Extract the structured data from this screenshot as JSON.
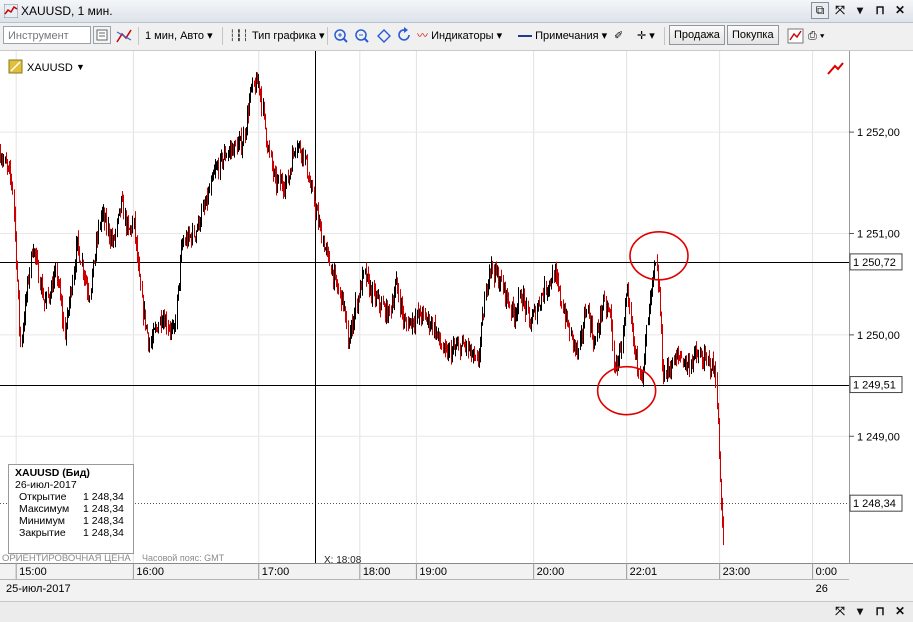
{
  "window": {
    "title": "XAUUSD, 1 мин.",
    "buttons": [
      "restore-icon",
      "close-icon",
      "pin-icon",
      "close-icon"
    ]
  },
  "toolbar": {
    "instrument_placeholder": "Инструмент",
    "timeframe": "1 мин, Авто",
    "chart_type": "Тип графика",
    "indicators": "Индикаторы",
    "notes": "Примечания",
    "sell": "Продажа",
    "buy": "Покупка"
  },
  "symbol_label": "XAUUSD",
  "info_box": {
    "title": "XAUUSD (Бид)",
    "date": "26-июл-2017",
    "rows": [
      {
        "label": "Открытие",
        "value": "1 248,34"
      },
      {
        "label": "Максимум",
        "value": "1 248,34"
      },
      {
        "label": "Минимум",
        "value": "1 248,34"
      },
      {
        "label": "Закрытие",
        "value": "1 248,34"
      }
    ]
  },
  "footer_text": {
    "price_mode": "ОРИЕНТИРОВОЧНАЯ ЦЕНА",
    "timezone": "Часовой пояс: GMT",
    "cursor_x": "X: 18:08"
  },
  "axis": {
    "x_ticks": [
      {
        "label": "15:00",
        "t": 2.0
      },
      {
        "label": "16:00",
        "t": 16.5
      },
      {
        "label": "17:00",
        "t": 32.0
      },
      {
        "label": "18:00",
        "t": 44.5
      },
      {
        "label": "19:00",
        "t": 51.5
      },
      {
        "label": "20:00",
        "t": 66.0
      },
      {
        "label": "22:01",
        "t": 77.5
      },
      {
        "label": "23:00",
        "t": 89.0
      },
      {
        "label": "0:00",
        "t": 100.5
      }
    ],
    "x_date": "25-июл-2017",
    "x_date_right": "26",
    "y_ticks": [
      "1 252,00",
      "1 251,00",
      "1 250,00",
      "1 249,00"
    ],
    "y_tick_values": [
      1252.0,
      1251.0,
      1250.0,
      1249.0
    ],
    "price_labels": [
      {
        "label": "1 250,72",
        "value": 1250.72
      },
      {
        "label": "1 249,51",
        "value": 1249.51
      },
      {
        "label": "1 248,34",
        "value": 1248.34
      }
    ]
  },
  "chart_data": {
    "type": "candlestick",
    "x_range": [
      0,
      105
    ],
    "ylim": [
      1247.75,
      1252.8
    ],
    "horizontal_lines": [
      1250.72,
      1249.51
    ],
    "dotted_line": 1248.34,
    "crosshair_x": 39,
    "annotations": [
      {
        "type": "circle",
        "x": 81.5,
        "y": 1250.78
      },
      {
        "type": "circle",
        "x": 77.5,
        "y": 1249.45
      }
    ],
    "up_color": "#000000",
    "down_color": "#cc0000",
    "anchors": [
      [
        0,
        1251.8
      ],
      [
        1.5,
        1251.5
      ],
      [
        2.5,
        1249.9
      ],
      [
        4,
        1250.9
      ],
      [
        5.5,
        1250.3
      ],
      [
        7,
        1250.6
      ],
      [
        8,
        1250.0
      ],
      [
        9.5,
        1250.9
      ],
      [
        11,
        1250.4
      ],
      [
        12.5,
        1251.2
      ],
      [
        14,
        1250.9
      ],
      [
        15,
        1251.3
      ],
      [
        15.8,
        1251.0
      ],
      [
        16.5,
        1251.1
      ],
      [
        17.5,
        1250.3
      ],
      [
        18.5,
        1249.9
      ],
      [
        20,
        1250.2
      ],
      [
        21.5,
        1250.0
      ],
      [
        22.5,
        1250.9
      ],
      [
        24,
        1251.0
      ],
      [
        25.5,
        1251.3
      ],
      [
        26.5,
        1251.6
      ],
      [
        28,
        1251.8
      ],
      [
        30,
        1251.9
      ],
      [
        31,
        1252.4
      ],
      [
        32,
        1252.5
      ],
      [
        33,
        1251.9
      ],
      [
        34,
        1251.5
      ],
      [
        35.5,
        1251.5
      ],
      [
        36.5,
        1251.9
      ],
      [
        37.5,
        1251.8
      ],
      [
        38.5,
        1251.4
      ],
      [
        40,
        1250.9
      ],
      [
        41.5,
        1250.5
      ],
      [
        42.5,
        1250.3
      ],
      [
        43,
        1249.9
      ],
      [
        44,
        1250.3
      ],
      [
        45,
        1250.6
      ],
      [
        46,
        1250.4
      ],
      [
        47,
        1250.3
      ],
      [
        48,
        1250.2
      ],
      [
        49,
        1250.5
      ],
      [
        50,
        1250.1
      ],
      [
        52,
        1250.2
      ],
      [
        53.5,
        1250.1
      ],
      [
        55,
        1249.8
      ],
      [
        56,
        1249.85
      ],
      [
        57.5,
        1249.9
      ],
      [
        59,
        1249.7
      ],
      [
        60.5,
        1250.7
      ],
      [
        62,
        1250.5
      ],
      [
        63.5,
        1250.2
      ],
      [
        64.5,
        1250.4
      ],
      [
        65.5,
        1250.1
      ],
      [
        67,
        1250.4
      ],
      [
        68.5,
        1250.6
      ],
      [
        69.5,
        1250.3
      ],
      [
        70.5,
        1250.0
      ],
      [
        71.5,
        1249.8
      ],
      [
        72.5,
        1250.3
      ],
      [
        73.5,
        1249.9
      ],
      [
        74.5,
        1250.3
      ],
      [
        75.5,
        1250.2
      ],
      [
        76,
        1249.6
      ],
      [
        77,
        1250.0
      ],
      [
        77.5,
        1250.4
      ],
      [
        78.5,
        1249.8
      ],
      [
        79.5,
        1249.6
      ],
      [
        80,
        1250.1
      ],
      [
        81,
        1250.7
      ],
      [
        81.5,
        1250.4
      ],
      [
        82,
        1249.6
      ],
      [
        83,
        1249.7
      ],
      [
        84,
        1249.8
      ],
      [
        85,
        1249.7
      ],
      [
        86,
        1249.8
      ],
      [
        87,
        1249.75
      ],
      [
        88,
        1249.7
      ],
      [
        88.5,
        1249.6
      ],
      [
        89,
        1248.6
      ],
      [
        89.5,
        1247.95
      ]
    ]
  }
}
